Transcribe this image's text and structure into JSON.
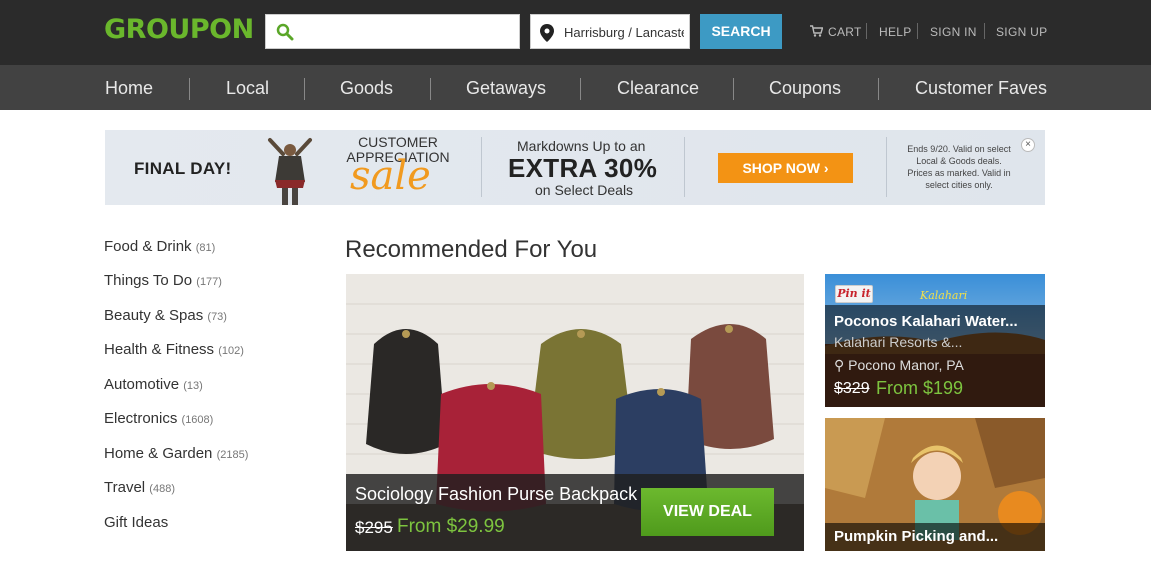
{
  "header": {
    "logo": "GROUPON",
    "search": {
      "value": "",
      "placeholder": ""
    },
    "location": {
      "value": "Harrisburg / Lancaster"
    },
    "search_button": "SEARCH",
    "links": [
      "CART",
      "HELP",
      "SIGN IN",
      "SIGN UP"
    ]
  },
  "nav": {
    "items": [
      "Home",
      "Local",
      "Goods",
      "Getaways",
      "Clearance",
      "Coupons",
      "Customer Faves"
    ]
  },
  "banner": {
    "final_day": "FINAL DAY!",
    "customer_appreciation": "CUSTOMER APPRECIATION",
    "sale": "sale",
    "markdowns": "Markdowns Up to an",
    "extra": "EXTRA 30%",
    "select_deals": "on Select Deals",
    "shop_now": "SHOP NOW",
    "fine_print": "Ends 9/20. Valid on select Local & Goods deals. Prices as marked. Valid in select cities only.",
    "close": "×"
  },
  "sidebar": {
    "categories": [
      {
        "label": "Food & Drink",
        "count": "(81)"
      },
      {
        "label": "Things To Do",
        "count": "(177)"
      },
      {
        "label": "Beauty & Spas",
        "count": "(73)"
      },
      {
        "label": "Health & Fitness",
        "count": "(102)"
      },
      {
        "label": "Automotive",
        "count": "(13)"
      },
      {
        "label": "Electronics",
        "count": "(1608)"
      },
      {
        "label": "Home & Garden",
        "count": "(2185)"
      },
      {
        "label": "Travel",
        "count": "(488)"
      },
      {
        "label": "Gift Ideas",
        "count": ""
      }
    ]
  },
  "main": {
    "title": "Recommended For You",
    "featured": {
      "title": "Sociology Fashion Purse Backpack",
      "old_price": "$295",
      "new_price": "From $29.99",
      "button": "VIEW DEAL"
    },
    "side_deals": [
      {
        "pin_it": "Pin it",
        "logo_text": "Kalahari",
        "title": "Poconos Kalahari Water...",
        "subtitle": "Kalahari Resorts &...",
        "location": "Pocono Manor, PA",
        "old_price": "$329",
        "new_price": "From $199"
      },
      {
        "title": "Pumpkin Picking and..."
      }
    ]
  },
  "colors": {
    "brand_green": "#6ab72c",
    "search_blue": "#3d9ac4",
    "shop_orange": "#f39314",
    "price_green": "#7dc43f"
  }
}
